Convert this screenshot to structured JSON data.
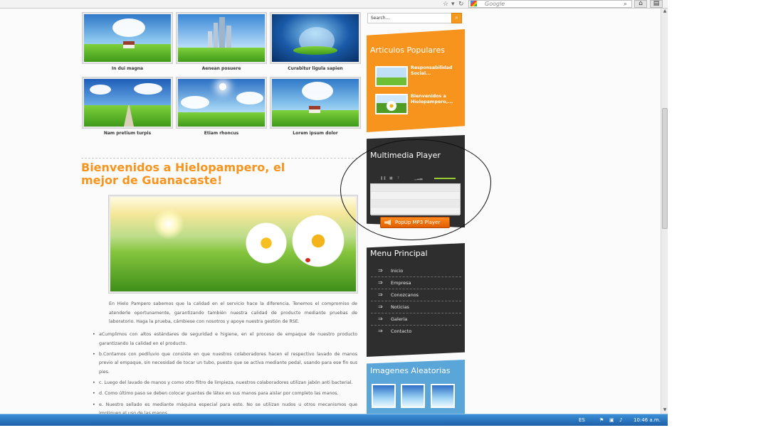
{
  "browser": {
    "search_placeholder": "Google",
    "star_icon": "star-icon",
    "refresh_icon": "refresh-icon",
    "home_icon": "home-icon",
    "bookmarks_icon": "bookmarks-icon"
  },
  "gallery": {
    "row1": [
      "In dui magna",
      "Aenean posuere",
      "Curabitur ligula sapien"
    ],
    "row2": [
      "Nam pretium turpis",
      "Etiam rhoncus",
      "Lorem ipsum dolor"
    ]
  },
  "article": {
    "title": "Bienvenidos a Hielopampero, el mejor de Guanacaste!",
    "intro": "En Hielo Pampero sabemos que la calidad en el servicio hace la diferencia. Tenemos el compromiso de atenderle oportunamente, garantizando también nuestra calidad de producto mediante pruebas de laboratorio. Haga la prueba, cámbiese con nosotros y apoye  nuestra gestión de RSE.",
    "bullets": [
      "aCumplimos con altos estándares de seguridad e higiene, en el proceso de empaque de nuestro producto garantizando la calidad en el producto.",
      "b.Contamos con pediluvio que consiste en que nuestros colaboradores hacen el respectivo lavado de manos previo al empaque,  sin necesidad de tocar un tubo, puesto que se activa mediante pedal, usando para ese fin sus pies.",
      "c. Luego del lavado de manos y como otro filtro de limpieza, nuestros colaboradores utilizan jabón anti bacterial.",
      "d. Como último paso se deben colocar guantes de látex en sus manos para aislar por completo las manos.",
      "e. Nuestro sellado es mediante máquina especial para esto. No se utilizan nudos u otros mecanismos que impliquen el uso de las manos."
    ]
  },
  "sidebar": {
    "search_placeholder": "Search...",
    "popular_title": "Articulos Populares",
    "popular_items": [
      "Responsabilidad Social...",
      "Bienvenidos a Hielopampero,..."
    ],
    "multimedia_title": "Multimedia Player",
    "popup_label": "PopUp MP3 Player",
    "menu_title": "Menu Principal",
    "menu_items": [
      "Inicio",
      "Empresa",
      "Conozcanos",
      "Noticias",
      "Galeria",
      "Contacto"
    ],
    "random_title": "Imagenes Aleatorias"
  },
  "taskbar": {
    "lang": "ES",
    "time": "10:46 a.m."
  },
  "colors": {
    "accent_orange": "#f7941d",
    "panel_dark": "#2e2e2e",
    "panel_blue": "#5aa6d8",
    "taskbar_blue": "#1d5fa8"
  }
}
